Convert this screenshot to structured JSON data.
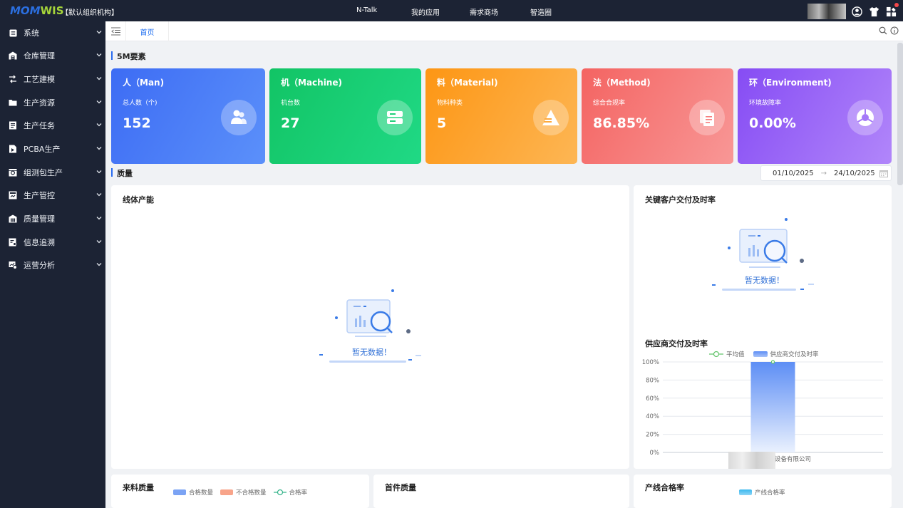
{
  "app": {
    "logo_part1": "MOM",
    "logo_part2": "WIS",
    "org": "【默认组织机构】"
  },
  "topnav": [
    "N-Talk",
    "我的应用",
    "需求商场",
    "智造圈"
  ],
  "sidebar": {
    "items": [
      {
        "label": "系统",
        "icon": "system-icon"
      },
      {
        "label": "仓库管理",
        "icon": "warehouse-icon"
      },
      {
        "label": "工艺建模",
        "icon": "process-icon"
      },
      {
        "label": "生产资源",
        "icon": "folder-icon"
      },
      {
        "label": "生产任务",
        "icon": "task-icon"
      },
      {
        "label": "PCBA生产",
        "icon": "pcba-icon"
      },
      {
        "label": "组测包生产",
        "icon": "package-icon"
      },
      {
        "label": "生产管控",
        "icon": "control-icon"
      },
      {
        "label": "质量管理",
        "icon": "quality-icon"
      },
      {
        "label": "信息追溯",
        "icon": "trace-icon"
      },
      {
        "label": "运营分析",
        "icon": "analysis-icon"
      }
    ]
  },
  "tabs": {
    "home": "首页"
  },
  "sections": {
    "fivem": "5M要素",
    "quality": "质量"
  },
  "kpis": [
    {
      "title": "人（Man)",
      "sub": "总人数（个)",
      "value": "152",
      "icon": "people-icon",
      "gradient": [
        "#3d6cf4",
        "#5a8ef9"
      ]
    },
    {
      "title": "机（Machine)",
      "sub": "机台数",
      "value": "27",
      "icon": "machine-icon",
      "gradient": [
        "#16c86a",
        "#1ed882"
      ]
    },
    {
      "title": "料（Material)",
      "sub": "物料种类",
      "value": "5",
      "icon": "material-icon",
      "gradient": [
        "#fd9b1a",
        "#fdb552"
      ]
    },
    {
      "title": "法（Method)",
      "sub": "综合合规率",
      "value": "86.85%",
      "icon": "method-icon",
      "gradient": [
        "#f56a68",
        "#f79291"
      ]
    },
    {
      "title": "环（Environment)",
      "sub": "环境故障率",
      "value": "0.00%",
      "icon": "environment-icon",
      "gradient": [
        "#8a52f5",
        "#ac7ff9"
      ]
    }
  ],
  "daterange": {
    "start": "01/10/2025",
    "end": "24/10/2025"
  },
  "panels": {
    "line_capacity": {
      "title": "线体产能",
      "empty": "暂无数据！"
    },
    "key_customer": {
      "title": "关键客户交付及时率",
      "empty": "暂无数据！"
    },
    "supplier": {
      "title": "供应商交付及时率"
    },
    "incoming": {
      "title": "来料质量",
      "legend": [
        "合格数量",
        "不合格数量",
        "合格率"
      ]
    },
    "first_article": {
      "title": "首件质量"
    },
    "line_pass": {
      "title": "产线合格率",
      "legend": [
        "产线合格率"
      ]
    }
  },
  "chart_data": {
    "type": "bar",
    "title": "供应商交付及时率",
    "categories": [
      "设备有限公司"
    ],
    "series": [
      {
        "name": "供应商交付及时率",
        "type": "bar",
        "values": [
          100
        ]
      },
      {
        "name": "平均值",
        "type": "line",
        "values": [
          100
        ]
      }
    ],
    "yticks": [
      "0%",
      "20%",
      "40%",
      "60%",
      "80%",
      "100%"
    ],
    "ylim": [
      0,
      100
    ],
    "grid": true,
    "legend": "top"
  },
  "colors": {
    "accent": "#1e6ef0",
    "sidebar_bg": "#1c2334",
    "bar_top": "#5d8ef5",
    "avg_line": "#62c46a"
  }
}
